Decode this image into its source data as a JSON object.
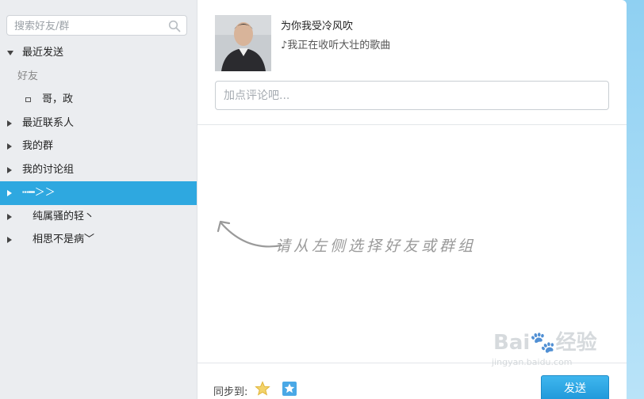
{
  "search": {
    "placeholder": "搜索好友/群"
  },
  "tree": {
    "recent_sent": "最近发送",
    "friends_header": "好友",
    "friend_item": "哥，政",
    "recent_contacts": "最近联系人",
    "my_groups": "我的群",
    "my_discussions": "我的讨论组",
    "group_active": "┅━＞＞",
    "group_2": "纯属骚的轻丶",
    "group_3": "相思不是病﹀"
  },
  "profile": {
    "name": "为你我受冷风吹",
    "status": "♪我正在收听大壮的歌曲"
  },
  "comment": {
    "placeholder": "加点评论吧..."
  },
  "hint": "请从左侧选择好友或群组",
  "footer": {
    "sync_label": "同步到:",
    "sync_icons": [
      "star-icon",
      "bookmark-star-icon"
    ],
    "send_label": "发送"
  },
  "watermark": {
    "brand": "Bai",
    "brand2": "经验",
    "url": "jingyan.baidu.com"
  },
  "colors": {
    "accent": "#2ea8e0",
    "sidebar_bg": "#ebedf0"
  }
}
